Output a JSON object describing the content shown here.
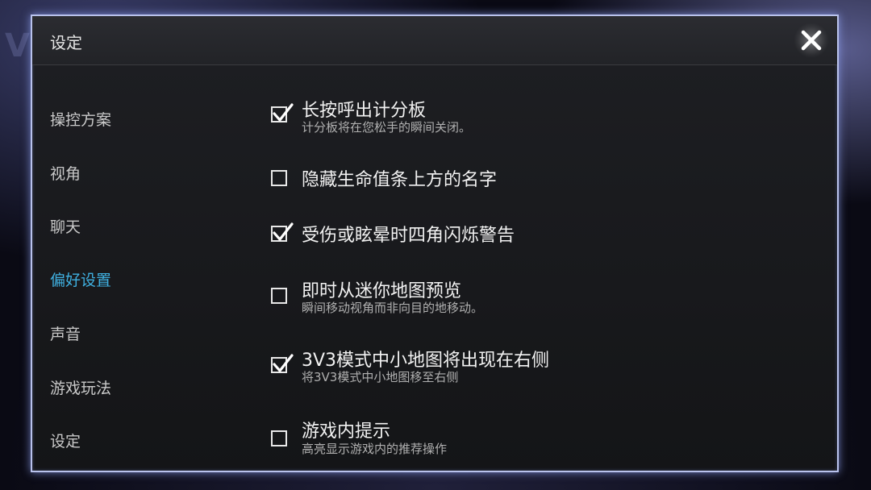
{
  "background": {
    "logo_text": "VG"
  },
  "dialog": {
    "title": "设定",
    "close_icon": "close-x-icon"
  },
  "sidebar": {
    "items": [
      {
        "label": "操控方案",
        "active": false
      },
      {
        "label": "视角",
        "active": false
      },
      {
        "label": "聊天",
        "active": false
      },
      {
        "label": "偏好设置",
        "active": true
      },
      {
        "label": "声音",
        "active": false
      },
      {
        "label": "游戏玩法",
        "active": false
      },
      {
        "label": "设定",
        "active": false
      }
    ],
    "active_color": "#3fb0e0"
  },
  "options": [
    {
      "label": "长按呼出计分板",
      "description": "计分板将在您松手的瞬间关闭。",
      "checked": true
    },
    {
      "label": "隐藏生命值条上方的名字",
      "description": "",
      "checked": false
    },
    {
      "label": "受伤或眩晕时四角闪烁警告",
      "description": "",
      "checked": true
    },
    {
      "label": "即时从迷你地图预览",
      "description": "瞬间移动视角而非向目的地移动。",
      "checked": false
    },
    {
      "label": "3V3模式中小地图将出现在右侧",
      "description": "将3V3模式中小地图移至右侧",
      "checked": true
    },
    {
      "label": "游戏内提示",
      "description": "高亮显示游戏内的推荐操作",
      "checked": false
    }
  ]
}
